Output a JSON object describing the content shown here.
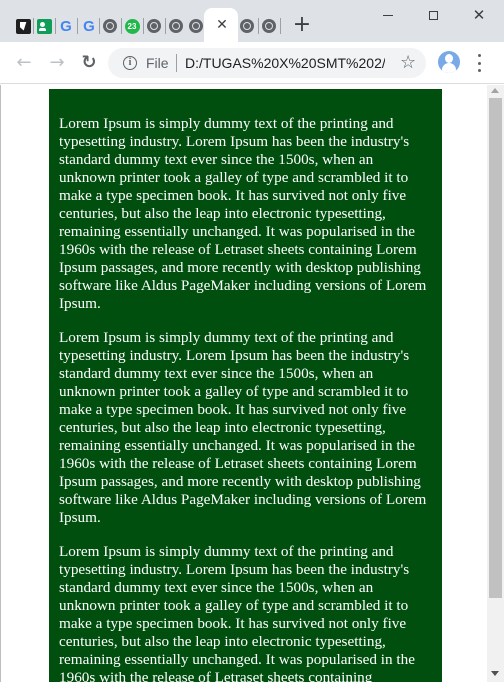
{
  "browser": {
    "tabs": [
      {
        "icon": "document-icon"
      },
      {
        "icon": "classroom-icon"
      },
      {
        "icon": "google-icon",
        "glyph": "G"
      },
      {
        "icon": "google-icon",
        "glyph": "G"
      },
      {
        "icon": "globe-icon"
      },
      {
        "icon": "notification-badge-icon",
        "badge": "23"
      },
      {
        "icon": "globe-icon"
      },
      {
        "icon": "globe-icon"
      },
      {
        "icon": "globe-icon",
        "active": true
      },
      {
        "icon": "globe-icon"
      },
      {
        "icon": "globe-icon"
      }
    ],
    "close_tab_glyph": "✕",
    "new_tab_glyph": "+",
    "window_controls": {
      "minimize": "",
      "maximize": "",
      "close": "✕"
    }
  },
  "toolbar": {
    "back_glyph": "←",
    "forward_glyph": "→",
    "reload_glyph": "↻",
    "info_glyph": "i",
    "scheme_label": "File",
    "url": "D:/TUGAS%20X%20SMT%202/...",
    "star_glyph": "☆"
  },
  "page": {
    "background_color": "#004f0f",
    "text_color": "#ffffff",
    "paragraphs": [
      "Lorem Ipsum is simply dummy text of the printing and typesetting industry. Lorem Ipsum has been the industry's standard dummy text ever since the 1500s, when an unknown printer took a galley of type and scrambled it to make a type specimen book. It has survived not only five centuries, but also the leap into electronic typesetting, remaining essentially unchanged. It was popularised in the 1960s with the release of Letraset sheets containing Lorem Ipsum passages, and more recently with desktop publishing software like Aldus PageMaker including versions of Lorem Ipsum.",
      "Lorem Ipsum is simply dummy text of the printing and typesetting industry. Lorem Ipsum has been the industry's standard dummy text ever since the 1500s, when an unknown printer took a galley of type and scrambled it to make a type specimen book. It has survived not only five centuries, but also the leap into electronic typesetting, remaining essentially unchanged. It was popularised in the 1960s with the release of Letraset sheets containing Lorem Ipsum passages, and more recently with desktop publishing software like Aldus PageMaker including versions of Lorem Ipsum.",
      "Lorem Ipsum is simply dummy text of the printing and typesetting industry. Lorem Ipsum has been the industry's standard dummy text ever since the 1500s, when an unknown printer took a galley of type and scrambled it to make a type specimen book. It has survived not only five centuries, but also the leap into electronic typesetting, remaining essentially unchanged. It was popularised in the 1960s with the release of Letraset sheets containing"
    ]
  }
}
